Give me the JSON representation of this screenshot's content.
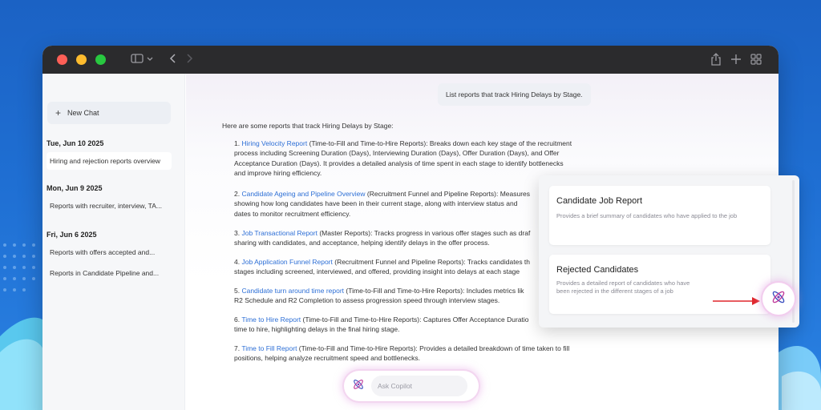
{
  "sidebar": {
    "new_chat": "New Chat",
    "groups": [
      {
        "date": "Tue, Jun 10 2025",
        "items": [
          "Hiring and rejection reports overview"
        ]
      },
      {
        "date": "Mon, Jun 9 2025",
        "items": [
          "Reports with recruiter, interview, TA..."
        ]
      },
      {
        "date": "Fri, Jun 6 2025",
        "items": [
          "Reports with offers accepted and...",
          "Reports in Candidate Pipeline and..."
        ]
      }
    ]
  },
  "chat": {
    "user_message": "List reports that track Hiring Delays by Stage.",
    "intro": "Here are some reports that track Hiring Delays by Stage:",
    "reports": [
      {
        "num": "1.",
        "name": "Hiring Velocity Report",
        "lines": [
          " (Time-to-Fill and Time-to-Hire Reports): Breaks down each key stage of the recruitment",
          "process including Screening Duration (Days), Interviewing Duration (Days), Offer Duration (Days), and Offer",
          "Acceptance Duration (Days). It provides a detailed analysis of time spent in each stage to identify bottlenecks",
          "and improve hiring efficiency."
        ]
      },
      {
        "num": "2.",
        "name": "Candidate Ageing and Pipeline Overview",
        "lines": [
          " (Recruitment Funnel and Pipeline Reports): Measures",
          "showing how long candidates have been in their current stage, along with interview status and",
          "dates to monitor recruitment efficiency."
        ]
      },
      {
        "num": "3.",
        "name": "Job Transactional Report",
        "lines": [
          " (Master Reports): Tracks progress in various offer stages such as draf",
          "sharing with candidates, and acceptance, helping identify delays in the offer process."
        ]
      },
      {
        "num": "4.",
        "name": "Job Application Funnel Report",
        "lines": [
          " (Recruitment Funnel and Pipeline Reports): Tracks candidates th",
          "stages including screened, interviewed, and offered, providing insight into delays at each stage"
        ]
      },
      {
        "num": "5.",
        "name": "Candidate turn around time report",
        "lines": [
          " (Time-to-Fill and Time-to-Hire Reports): Includes metrics lik",
          "R2 Schedule and R2 Completion to assess progression speed through interview stages."
        ]
      },
      {
        "num": "6.",
        "name": "Time to Hire Report",
        "lines": [
          " (Time-to-Fill and Time-to-Hire Reports): Captures Offer Acceptance Duratio",
          "time to hire, highlighting delays in the final hiring stage."
        ]
      },
      {
        "num": "7.",
        "name": "Time to Fill Report",
        "lines": [
          " (Time-to-Fill and Time-to-Hire Reports): Provides a detailed breakdown of time taken to fill",
          "positions, helping analyze recruitment speed and bottlenecks."
        ]
      }
    ],
    "ask_placeholder": "Ask Copilot"
  },
  "popup": {
    "cards": [
      {
        "title": "Candidate Job Report",
        "desc": "Provides a brief summary of candidates who have applied to the job"
      },
      {
        "title": "Rejected Candidates",
        "desc": "Provides a detailed report of candidates who have been rejected in the different stages of a job"
      }
    ]
  },
  "colors": {
    "link": "#2d6fd6",
    "accent_red": "#e0262c",
    "brand_purple": "#7b3fb3"
  },
  "icons": [
    "sidebar-toggle-icon",
    "chevron-down-icon",
    "back-icon",
    "forward-icon",
    "share-icon",
    "new-tab-icon",
    "tab-grid-icon",
    "copilot-atom-icon",
    "arrow-icon"
  ]
}
